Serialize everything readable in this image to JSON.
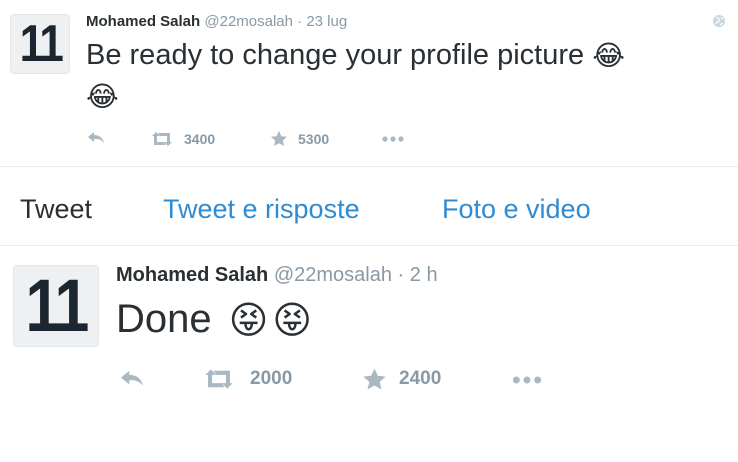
{
  "tweet1": {
    "avatar_text": "11",
    "author_name": "Mohamed Salah",
    "handle": "@22mosalah",
    "separator": "·",
    "time": "23 lug",
    "text": "Be ready to change your profile picture",
    "emoji": "😂",
    "retweets": "3400",
    "favorites": "5300",
    "icons": [
      "reply-icon",
      "retweet-icon",
      "favorite-icon",
      "more-icon",
      "globe-icon"
    ]
  },
  "tabs": [
    {
      "label": "Tweet"
    },
    {
      "label": "Tweet e risposte"
    },
    {
      "label": "Foto e video"
    }
  ],
  "tweet2": {
    "avatar_text": "11",
    "author_name": "Mohamed Salah",
    "handle": "@22mosalah",
    "separator": "·",
    "time": "2 h",
    "text": "Done",
    "emoji": "😝",
    "retweets": "2000",
    "favorites": "2400",
    "icons": [
      "reply-icon",
      "retweet-icon",
      "favorite-icon",
      "more-icon"
    ]
  },
  "colors": {
    "link": "#2f8bd2",
    "muted": "#8899a6",
    "icon": "#aab8c2",
    "divider": "#e6ecf0"
  }
}
